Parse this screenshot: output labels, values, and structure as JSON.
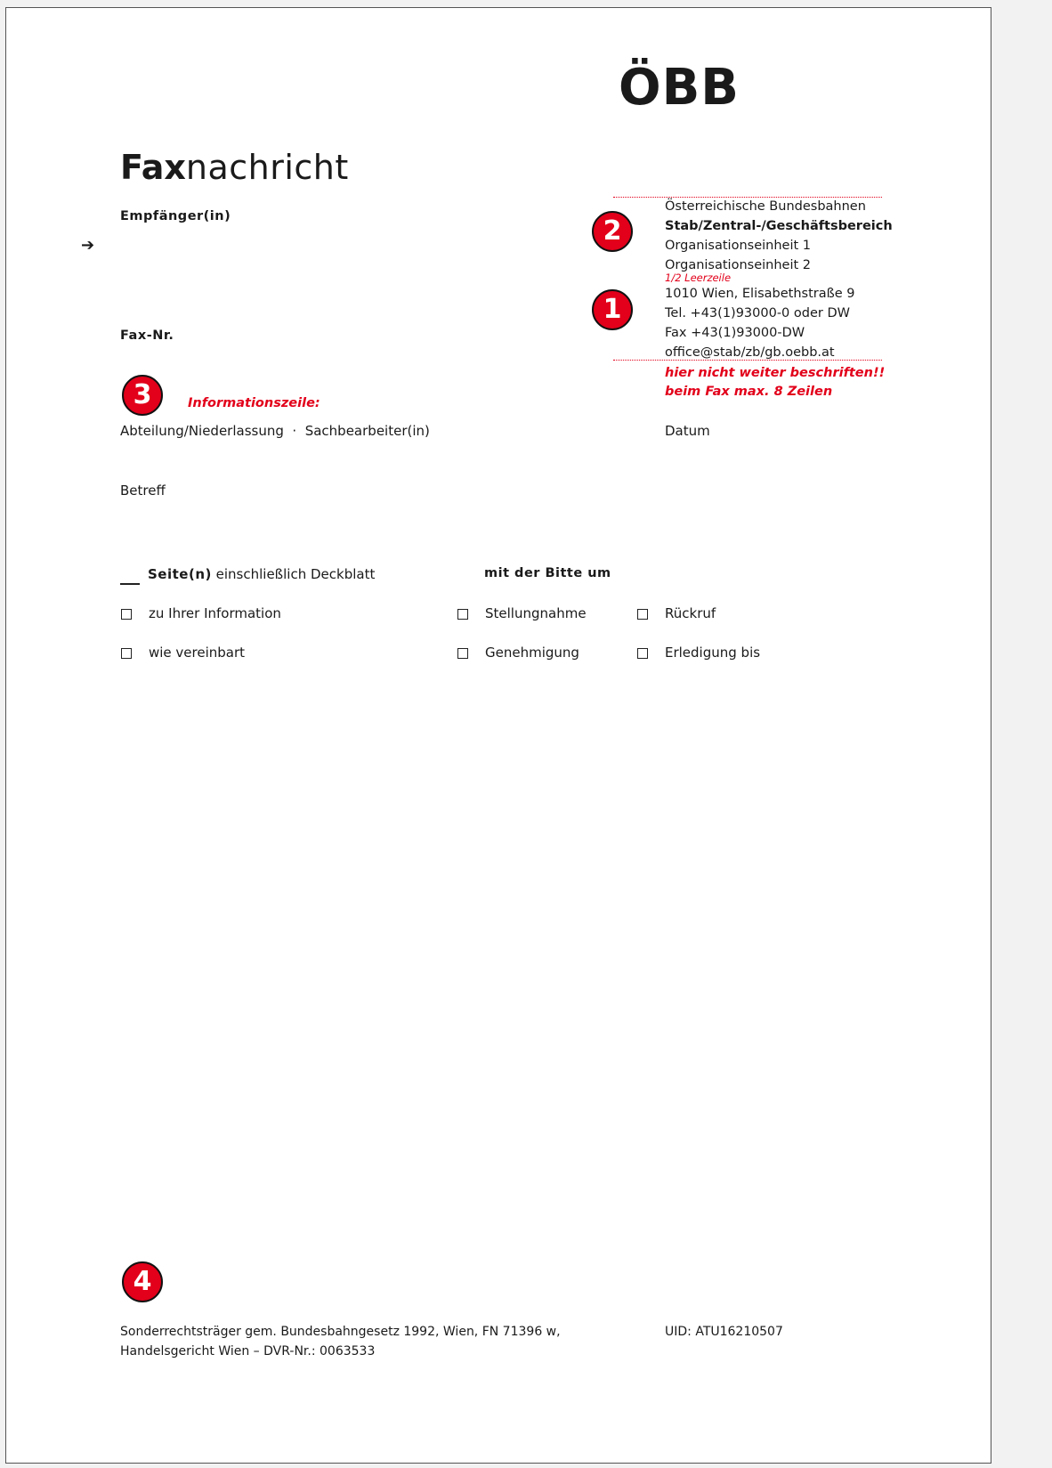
{
  "logo": {
    "text": "ÖBB"
  },
  "title": {
    "bold": "Fax",
    "light": "nachricht"
  },
  "recipient": {
    "label": "Empfänger(in)",
    "arrow": "➔"
  },
  "fax": {
    "label": "Fax-Nr."
  },
  "markers": [
    "1",
    "2",
    "3",
    "4"
  ],
  "sender": {
    "lines": [
      "Österreichische Bundesbahnen",
      "Stab/Zentral-/Geschäftsbereich",
      "Organisationseinheit 1",
      "Organisationseinheit 2"
    ],
    "half_line_note": "1/2 Leerzeile",
    "address": [
      "1010 Wien, Elisabethstraße 9",
      "Tel. +43(1)93000-0 oder DW",
      "Fax +43(1)93000-DW",
      "office@stab/zb/gb.oebb.at"
    ],
    "warning": [
      "hier nicht weiter beschriften!!",
      "beim Fax max. 8 Zeilen"
    ]
  },
  "info": {
    "heading": "Informationszeile:",
    "line": "Abteilung/Niederlassung  ·  Sachbearbeiter(in)",
    "date_label": "Datum"
  },
  "subject": {
    "label": "Betreff"
  },
  "pages": {
    "bold": "Seite(n)",
    "rest": "einschließlich Deckblatt"
  },
  "request": {
    "heading": "mit der Bitte um",
    "checkboxes": [
      "zu Ihrer Information",
      "wie vereinbart",
      "Stellungnahme",
      "Genehmigung",
      "Rückruf",
      "Erledigung bis"
    ]
  },
  "footer": {
    "left": [
      "Sonderrechtsträger gem. Bundesbahngesetz 1992, Wien, FN 71396 w,",
      "Handelsgericht Wien – DVR-Nr.: 0063533"
    ],
    "right": "UID: ATU16210507"
  },
  "colors": {
    "accent": "#e2001a",
    "text": "#1a1a1a"
  }
}
